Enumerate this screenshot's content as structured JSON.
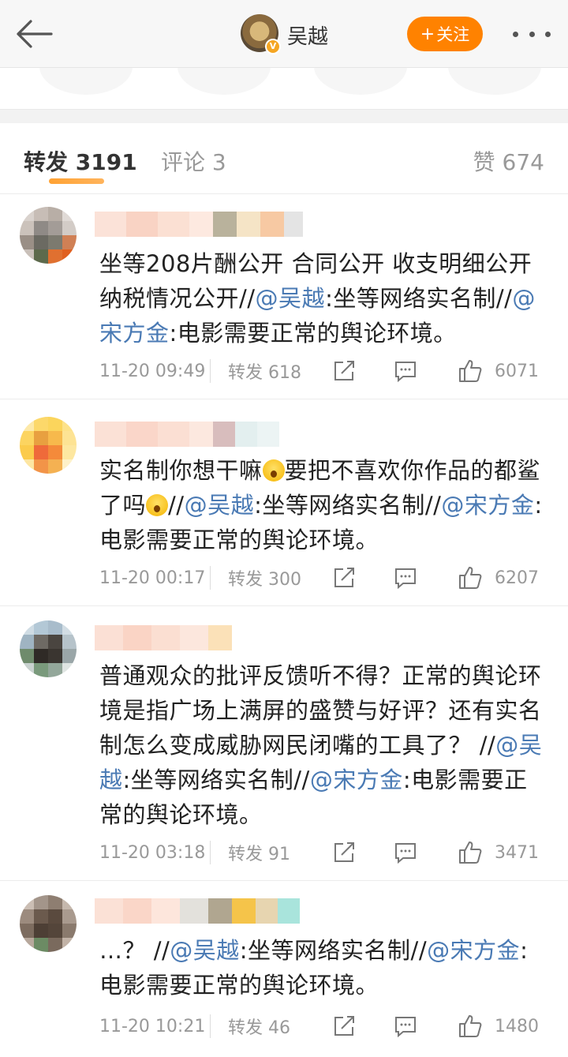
{
  "header": {
    "back_icon": "back-arrow-icon",
    "title": "吴越",
    "verified_badge": "V",
    "follow_label": "关注",
    "follow_plus": "+",
    "more_icon": "more-dots-icon",
    "accent": "#ff8200"
  },
  "tabs": {
    "repost": "转发 3191",
    "comment": "评论 3",
    "like": "赞 674"
  },
  "posts": [
    {
      "text": [
        {
          "t": "坐等208片酬公开 合同公开 收支明细公开 纳税情况公开//"
        },
        {
          "t": "@吴越",
          "m": true
        },
        {
          "t": ":坐等网络实名制//"
        },
        {
          "t": "@宋方金",
          "m": true
        },
        {
          "t": ":电影需要正常的舆论环境。"
        }
      ],
      "time": "11-20 09:49",
      "repost": "转发 618",
      "likes": "6071"
    },
    {
      "text": [
        {
          "t": "实名制你想干嘛"
        },
        {
          "e": "surprised-emoji-icon"
        },
        {
          "t": "要把不喜欢你作品的都鲨了吗"
        },
        {
          "e": "surprised-emoji-icon"
        },
        {
          "t": "//"
        },
        {
          "t": "@吴越",
          "m": true
        },
        {
          "t": ":坐等网络实名制//"
        },
        {
          "t": "@宋方金",
          "m": true
        },
        {
          "t": ":电影需要正常的舆论环境。"
        }
      ],
      "time": "11-20 00:17",
      "repost": "转发 300",
      "likes": "6207"
    },
    {
      "text": [
        {
          "t": "普通观众的批评反馈听不得？正常的舆论环境是指广场上满屏的盛赞与好评？还有实名制怎么变成威胁网民闭嘴的工具了？ //"
        },
        {
          "t": "@吴越",
          "m": true
        },
        {
          "t": ":坐等网络实名制//"
        },
        {
          "t": "@宋方金",
          "m": true
        },
        {
          "t": ":电影需要正常的舆论环境。"
        }
      ],
      "time": "11-20 03:18",
      "repost": "转发 91",
      "likes": "3471"
    },
    {
      "text": [
        {
          "t": "…？ //"
        },
        {
          "t": "@吴越",
          "m": true
        },
        {
          "t": ":坐等网络实名制//"
        },
        {
          "t": "@宋方金",
          "m": true
        },
        {
          "t": ":电影需要正常的舆论环境。"
        }
      ],
      "time": "11-20 10:21",
      "repost": "转发 46",
      "likes": "1480"
    }
  ],
  "colors": {
    "mention": "#4a7ab4",
    "muted": "#999999",
    "text": "#222222"
  }
}
